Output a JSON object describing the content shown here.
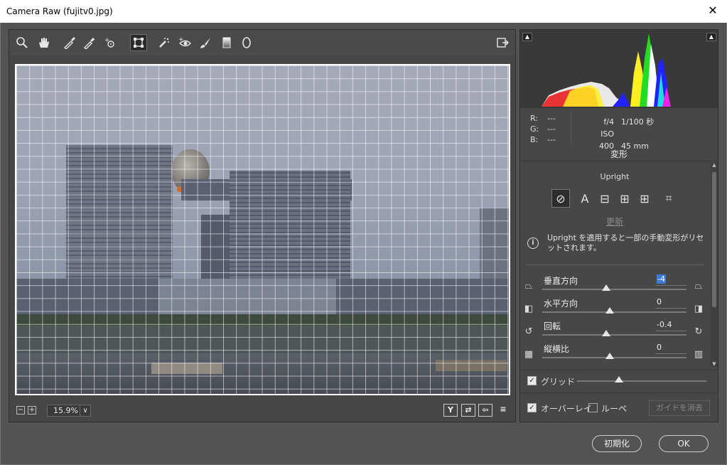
{
  "window": {
    "title": "Camera Raw (fujitv0.jpg)",
    "close_glyph": "✕"
  },
  "toolbar": {
    "tools": [
      "zoom-tool",
      "hand-tool",
      "white-balance-tool",
      "color-sampler-tool",
      "targeted-adjustment-tool",
      "transform-tool",
      "spot-removal-tool",
      "red-eye-tool",
      "adjustment-brush",
      "graduated-filter",
      "radial-filter"
    ],
    "active_tool": "transform-tool"
  },
  "status": {
    "zoom": "15.9%",
    "minus": "−",
    "plus": "+",
    "dropdown": "∨",
    "icons": [
      "Y",
      "⇄",
      "⇦",
      "≡"
    ]
  },
  "histogram": {
    "clip_shadow": "▲",
    "clip_highlight": "▲"
  },
  "readout": {
    "r_label": "R:",
    "r_value": "---",
    "g_label": "G:",
    "g_value": "---",
    "b_label": "B:",
    "b_value": "---",
    "aperture": "f/4",
    "shutter": "1/100 秒",
    "iso": "ISO 400",
    "focal": "45 mm"
  },
  "panel": {
    "title": "変形",
    "upright_label": "Upright",
    "upright_buttons": [
      "⊘",
      "A",
      "⊟",
      "⊞",
      "⊞",
      "⌗"
    ],
    "update_link": "更新",
    "info_text": "Upright を適用すると一部の手動変形がリセットされます。"
  },
  "sliders": [
    {
      "label": "垂直方向",
      "value": "-4",
      "selected": true,
      "position": 0.48
    },
    {
      "label": "水平方向",
      "value": "0",
      "selected": false,
      "position": 0.5
    },
    {
      "label": "回転",
      "value": "-0.4",
      "selected": false,
      "position": 0.48
    },
    {
      "label": "縦横比",
      "value": "0",
      "selected": false,
      "position": 0.5
    }
  ],
  "grid": {
    "label": "グリッド",
    "checked": true,
    "position": 0.3
  },
  "overlay": {
    "overlay_label": "オーバーレイ",
    "overlay_checked": true,
    "loupe_label": "ルーペ",
    "loupe_checked": false,
    "clear_guides": "ガイドを消去"
  },
  "footer": {
    "reset": "初期化",
    "ok": "OK"
  }
}
